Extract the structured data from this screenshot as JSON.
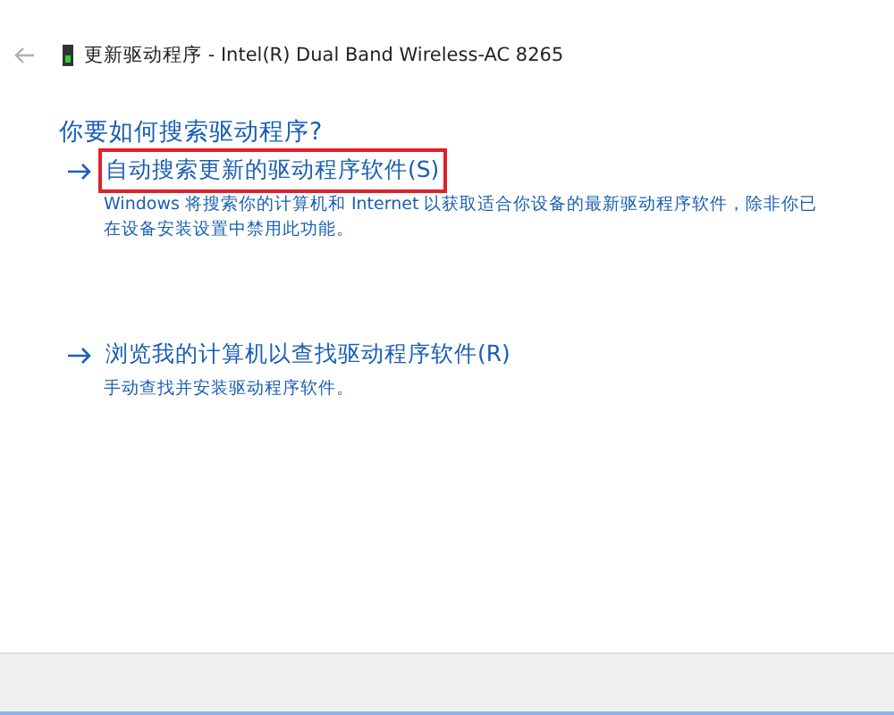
{
  "window": {
    "title": "更新驱动程序 - Intel(R) Dual Band Wireless-AC 8265"
  },
  "heading": "你要如何搜索驱动程序?",
  "options": [
    {
      "title": "自动搜索更新的驱动程序软件(S)",
      "description": "Windows 将搜索你的计算机和 Internet 以获取适合你设备的最新驱动程序软件，除非你已在设备安装设置中禁用此功能。",
      "highlighted": true
    },
    {
      "title": "浏览我的计算机以查找驱动程序软件(R)",
      "description": "手动查找并安装驱动程序软件。",
      "highlighted": false
    }
  ]
}
